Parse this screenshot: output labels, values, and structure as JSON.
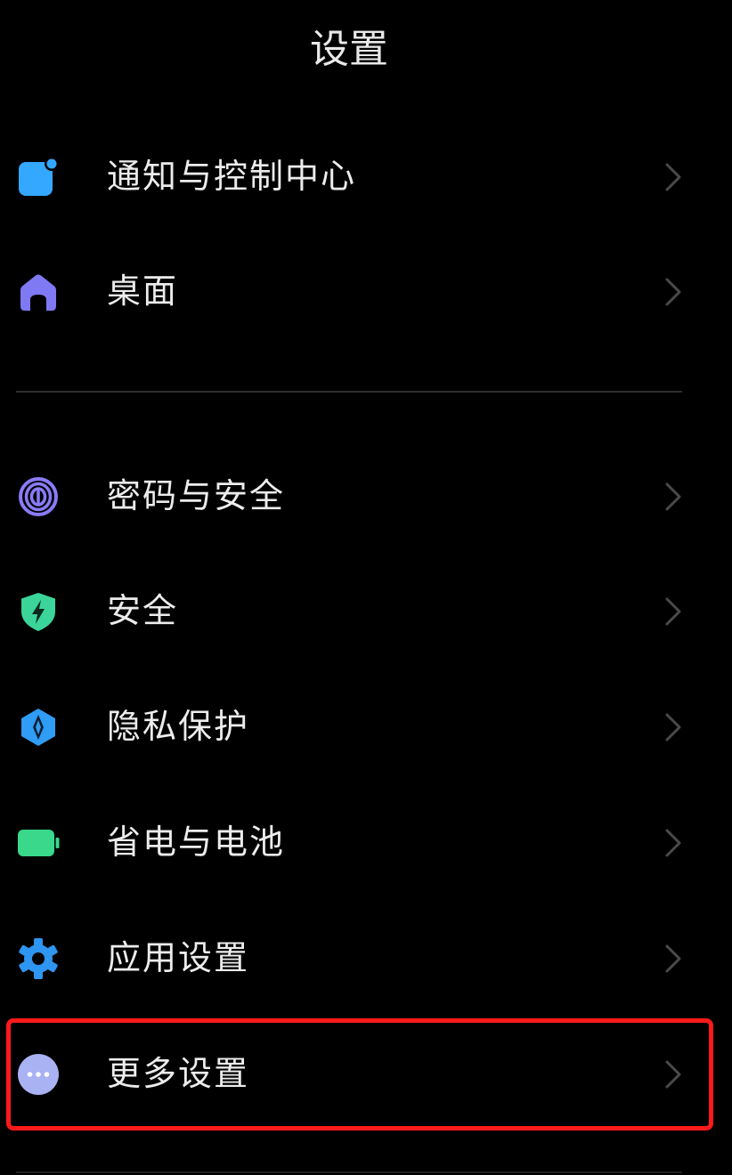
{
  "header": {
    "title": "设置"
  },
  "items": [
    {
      "id": "notification",
      "label": "通知与控制中心",
      "icon": "notification-icon",
      "color": "#34a8ff"
    },
    {
      "id": "home",
      "label": "桌面",
      "icon": "home-icon",
      "color": "#7f79f4"
    },
    {
      "id": "password",
      "label": "密码与安全",
      "icon": "fingerprint-icon",
      "color": "#8a7bf7"
    },
    {
      "id": "security",
      "label": "安全",
      "icon": "shield-icon",
      "color": "#3bd59a"
    },
    {
      "id": "privacy",
      "label": "隐私保护",
      "icon": "privacy-icon",
      "color": "#2f9cf5"
    },
    {
      "id": "battery",
      "label": "省电与电池",
      "icon": "battery-icon",
      "color": "#39d88b"
    },
    {
      "id": "apps",
      "label": "应用设置",
      "icon": "gear-icon",
      "color": "#2e95f0"
    },
    {
      "id": "more",
      "label": "更多设置",
      "icon": "more-icon",
      "color": "#a9b2f3"
    }
  ],
  "highlight": {
    "target": "more",
    "color": "#ff1a1a"
  }
}
